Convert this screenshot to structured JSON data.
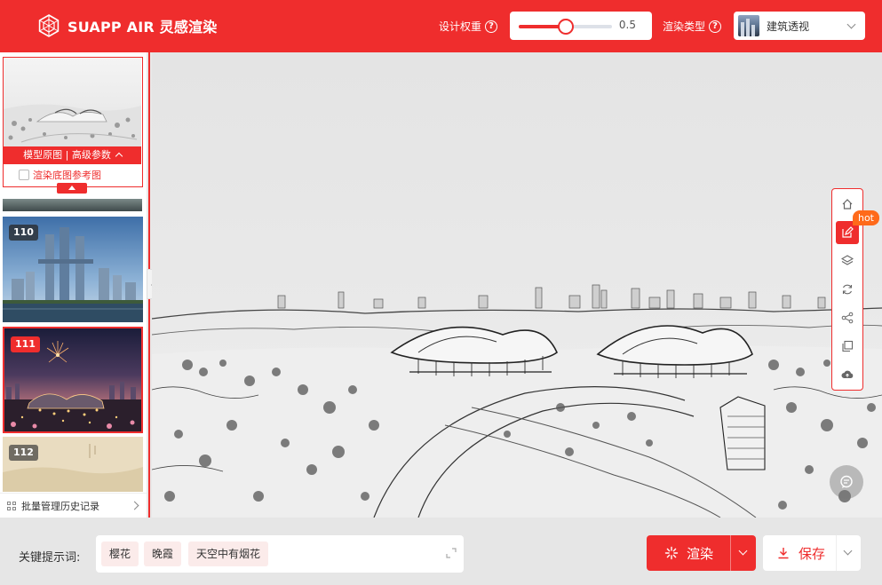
{
  "header": {
    "brand_title": "SUAPP AIR 灵感渲染",
    "weight_label": "设计权重",
    "weight_value": 0.5,
    "weight_display": "0.5",
    "render_type_label": "渲染类型",
    "render_type_value": "建筑透视"
  },
  "sidebar": {
    "model_bar_label": "模型原图 | 高级参数",
    "ref_checkbox_label": "渲染底图参考图",
    "history": [
      {
        "number": "110",
        "selected": false
      },
      {
        "number": "111",
        "selected": true
      },
      {
        "number": "112",
        "selected": false
      }
    ],
    "bulk_manage_label": "批量管理历史记录"
  },
  "toolbar": {
    "tools": [
      "home-icon",
      "edit-icon",
      "layers-icon",
      "refresh-icon",
      "share-icon",
      "copy-icon",
      "upload-cloud-icon"
    ],
    "active_tool": "edit-icon",
    "hot_badge": "hot"
  },
  "prompt": {
    "label": "关键提示词:",
    "tags": [
      "樱花",
      "晚霞",
      "天空中有烟花"
    ]
  },
  "actions": {
    "render_label": "渲染",
    "save_label": "保存"
  },
  "colors": {
    "brand_red": "#ef2d2d",
    "hot_orange": "#ff6a1a",
    "tag_bg": "#fbebea"
  }
}
